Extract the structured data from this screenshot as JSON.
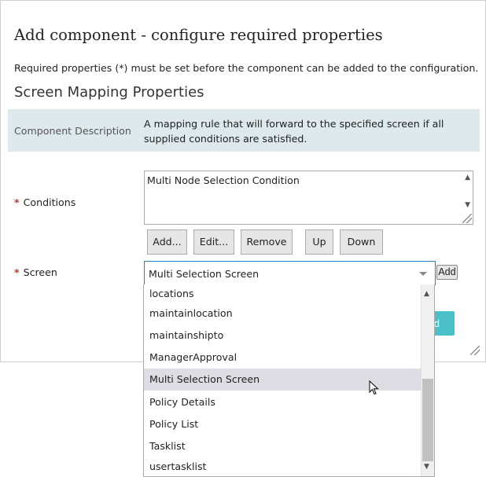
{
  "dialog": {
    "title": "Add component - configure required properties",
    "instructions": "Required properties (*) must be set before the component can be added to the configuration.",
    "section_title": "Screen Mapping Properties"
  },
  "component_description": {
    "label": "Component Description",
    "value": "A mapping rule that will forward to the specified screen if all supplied conditions are satisfied."
  },
  "conditions": {
    "required_mark": "*",
    "label": "Conditions",
    "value": "Multi Node Selection Condition",
    "buttons": {
      "add": "Add...",
      "edit": "Edit...",
      "remove": "Remove",
      "up": "Up",
      "down": "Down"
    }
  },
  "screen": {
    "required_mark": "*",
    "label": "Screen",
    "selected_value": "Multi Selection Screen",
    "add_label": "Add",
    "options": [
      "locations",
      "maintainlocation",
      "maintainshipto",
      "ManagerApproval",
      "Multi Selection Screen",
      "Policy Details",
      "Policy List",
      "Tasklist",
      "usertasklist"
    ],
    "highlighted_option": "Multi Selection Screen"
  },
  "footer": {
    "partial_button_label": "d"
  },
  "icons": {
    "caret": "chevron-down-icon",
    "scroll_up": "scroll-up-arrow-icon",
    "scroll_down": "scroll-down-arrow-icon",
    "resize": "resize-grip-icon",
    "cursor": "mouse-pointer-icon"
  },
  "colors": {
    "description_bg": "#dde9ec",
    "required_star": "#c0392b",
    "select_focus_border": "#1e84c7",
    "primary_button": "#4bc0c8",
    "option_highlight": "#dddde3"
  }
}
